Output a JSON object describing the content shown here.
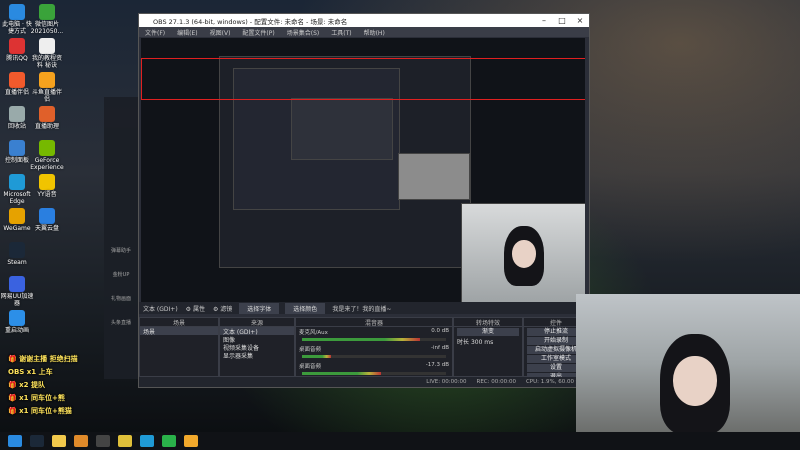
{
  "desktop": {
    "icons": [
      {
        "label": "此电脑 · 快捷方式",
        "color": "#2a8ae0"
      },
      {
        "label": "微信图片 2021050...",
        "color": "#3aa33a"
      },
      {
        "label": "腾讯QQ",
        "color": "#d33"
      },
      {
        "label": "我的教程资料 秘诀",
        "color": "#eee"
      },
      {
        "label": "直播伴侣",
        "color": "#f25a2c"
      },
      {
        "label": "斗鱼直播伴侣",
        "color": "#f6a21e"
      },
      {
        "label": "回收站",
        "color": "#9aa"
      },
      {
        "label": "直播助理",
        "color": "#e0602a"
      },
      {
        "label": "控制面板",
        "color": "#3a80d0"
      },
      {
        "label": "GeForce Experience",
        "color": "#76b900"
      },
      {
        "label": "Microsoft Edge",
        "color": "#1f9ad6"
      },
      {
        "label": "YY语音",
        "color": "#f1c400"
      },
      {
        "label": "WeGame",
        "color": "#e6a200"
      },
      {
        "label": "天翼云盘",
        "color": "#2a7fe0"
      },
      {
        "label": "Steam",
        "color": "#1b2838"
      },
      {
        "label": "网易UU加速器",
        "color": "#3a62e0"
      },
      {
        "label": "重启动画",
        "color": "#2c8fe8"
      }
    ],
    "overlay_lines": [
      {
        "icon": "gift-icon",
        "text": "谢谢主播 拒绝扫描"
      },
      {
        "icon": "gift-icon",
        "text": "x1 上车"
      },
      {
        "icon": "gift-icon",
        "text": "x2 提队"
      },
      {
        "icon": "gift-icon",
        "text": "x1 同车位+熊"
      },
      {
        "icon": "gift-icon",
        "text": "x1 同车位+熊猫"
      }
    ],
    "overlay_prefix": "OBS"
  },
  "obs": {
    "title": "OBS 27.1.3 (64-bit, windows) - 配置文件: 未命名 - 场景: 未命名",
    "menu": [
      "文件(F)",
      "编辑(E)",
      "视图(V)",
      "配置文件(P)",
      "场景集合(S)",
      "工具(T)",
      "帮助(H)"
    ],
    "controls_bar": {
      "source_name": "文本 (GDI+)",
      "properties": "属性",
      "filters": "滤镜",
      "tab1": "选择字体",
      "tab2": "选择颜色",
      "text_preview": "我是来了！我的直播~"
    },
    "scenes": {
      "header": "场景",
      "items": [
        "场景"
      ]
    },
    "sources": {
      "header": "来源",
      "items": [
        "文本 (GDI+)",
        "图像",
        "视频采集设备",
        "显示器采集"
      ]
    },
    "mixer": {
      "header": "混音器",
      "channels": [
        {
          "name": "麦克风/Aux",
          "db": "0.0 dB",
          "level": 0.82
        },
        {
          "name": "桌面音频",
          "db": "-inf dB",
          "level": 0.2
        },
        {
          "name": "桌面音频",
          "db": "-17.3 dB",
          "level": 0.55
        }
      ]
    },
    "transitions": {
      "header": "转场特效",
      "type": "渐变",
      "duration_label": "时长",
      "duration_value": "300 ms"
    },
    "controls": {
      "header": "控件",
      "buttons": [
        "停止推流",
        "开始录制",
        "启动虚拟摄像机",
        "工作室模式",
        "设置",
        "退出"
      ]
    },
    "status": {
      "live": "LIVE: 00:00:00",
      "rec": "REC: 00:00:00",
      "cpu": "CPU: 1.9%, 60.00 fps"
    }
  },
  "side_app": {
    "items": [
      "弹幕助手",
      "金粉UP",
      "礼物画面",
      "头条直播"
    ]
  },
  "taskbar": {
    "apps": [
      {
        "name": "windows-start-icon",
        "color": "#2a8ae0"
      },
      {
        "name": "steam-icon",
        "color": "#1b2838"
      },
      {
        "name": "file-explorer-icon",
        "color": "#f2c94c"
      },
      {
        "name": "app-icon",
        "color": "#e08a2a"
      },
      {
        "name": "obs-icon",
        "color": "#444"
      },
      {
        "name": "chrome-icon",
        "color": "#e0c03a"
      },
      {
        "name": "edge-icon",
        "color": "#1f9ad6"
      },
      {
        "name": "wechat-icon",
        "color": "#2ab24a"
      },
      {
        "name": "folder-icon",
        "color": "#f2a92c"
      }
    ]
  },
  "colors": {
    "accent": "#e02020",
    "obs_bg": "#2b2e38",
    "panel_bg": "#1f2128"
  }
}
